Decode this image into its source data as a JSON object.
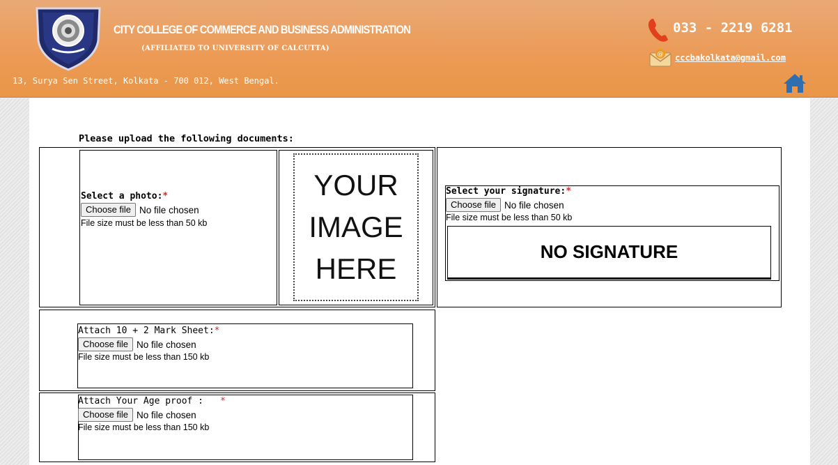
{
  "header": {
    "college_name": "CITY COLLEGE OF COMMERCE AND BUSINESS ADMINISTRATION",
    "affiliation": "(AFFILIATED TO UNIVERSITY OF CALCUTTA)",
    "address": "13, Surya Sen Street, Kolkata - 700 012, West Bengal.",
    "phone": "033 - 2219 6281",
    "email": "cccbakolkata@gmail.com",
    "icons": {
      "logo": "college-crest-logo",
      "phone": "phone-icon",
      "mail": "mail-icon",
      "home": "home-icon"
    },
    "colors": {
      "bar": "#ec9a55",
      "home": "#2f6fb0"
    }
  },
  "form": {
    "instruction": "Please upload the following documents:",
    "photo": {
      "label": "Select a photo:",
      "required_mark": "*",
      "button": "Choose file",
      "status": "No file chosen",
      "note": "File size must be less than 50 kb",
      "placeholder_lines": [
        "YOUR",
        "IMAGE",
        "HERE"
      ]
    },
    "signature": {
      "label": "Select your signature:",
      "required_mark": "*",
      "button": "Choose file",
      "status": "No file chosen",
      "note": "File size must be less than 50 kb",
      "placeholder": "NO SIGNATURE"
    },
    "marksheet": {
      "label": "Attach 10 + 2 Mark Sheet:",
      "required_mark": "*",
      "button": "Choose file",
      "status": "No file chosen",
      "note": "File size must be less than 150 kb"
    },
    "age_proof": {
      "label": "Attach Your Age proof :",
      "required_mark": "*",
      "button": "Choose file",
      "status": "No file chosen",
      "note": "File size must be less than 150 kb"
    }
  }
}
